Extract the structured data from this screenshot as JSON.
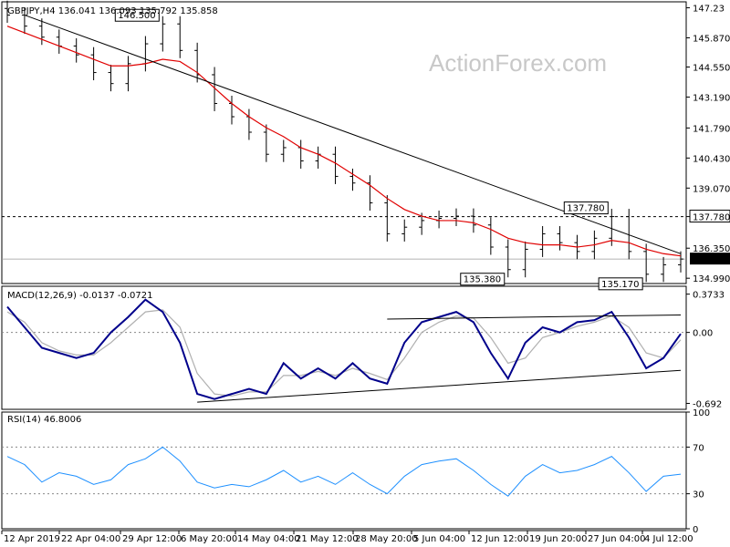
{
  "chart_data": [
    {
      "type": "candlestick",
      "title": "GBPJPY,H4",
      "ohlc": "136.041 136.093 135.792 135.858",
      "watermark": "ActionForex.com",
      "y_ticks": [
        "147.23",
        "145.870",
        "144.550",
        "143.190",
        "141.790",
        "140.430",
        "139.070",
        "137.780",
        "136.350",
        "134.990"
      ],
      "current_price": "135.858",
      "ylim": [
        134.75,
        147.5
      ],
      "x_labels": [
        "12 Apr 2019",
        "22 Apr 04:00",
        "29 Apr 12:00",
        "6 May 20:00",
        "14 May 04:00",
        "21 May 12:00",
        "28 May 20:00",
        "5 Jun 04:00",
        "12 Jun 12:00",
        "19 Jun 20:00",
        "27 Jun 04:00",
        "4 Jul 12:00"
      ],
      "close": [
        146.9,
        146.4,
        145.9,
        145.5,
        145.1,
        144.3,
        143.8,
        144.7,
        145.6,
        146.5,
        145.3,
        144.2,
        142.9,
        142.3,
        141.6,
        140.6,
        140.9,
        140.3,
        140.6,
        139.6,
        139.3,
        138.4,
        137.0,
        137.3,
        137.6,
        137.7,
        137.8,
        137.4,
        136.4,
        135.38,
        136.3,
        137.0,
        136.6,
        136.2,
        136.8,
        137.78,
        136.2,
        135.17,
        135.6,
        135.858
      ],
      "moving_average": [
        146.4,
        146.1,
        145.8,
        145.5,
        145.2,
        144.9,
        144.6,
        144.6,
        144.7,
        144.9,
        144.8,
        144.3,
        143.6,
        142.9,
        142.3,
        141.8,
        141.4,
        140.9,
        140.6,
        140.2,
        139.7,
        139.2,
        138.6,
        138.1,
        137.8,
        137.6,
        137.6,
        137.5,
        137.2,
        136.8,
        136.6,
        136.5,
        136.5,
        136.4,
        136.5,
        136.7,
        136.6,
        136.3,
        136.1,
        136.0
      ],
      "trendline": {
        "from": [
          1,
          146.9
        ],
        "to": [
          39,
          136.1
        ]
      },
      "resistance_level": 137.78,
      "annotations": [
        {
          "text": "146.500",
          "at": [
            9,
            146.5
          ]
        },
        {
          "text": "137.780",
          "at": [
            35,
            137.78
          ]
        },
        {
          "text": "135.380",
          "at": [
            29,
            135.38
          ]
        },
        {
          "text": "135.170",
          "at": [
            37,
            135.17
          ]
        }
      ]
    },
    {
      "type": "line",
      "title": "MACD(12,26,9) -0.0137 -0.0721",
      "y_ticks": [
        "0.3733",
        "0.00",
        "-0.692"
      ],
      "ylim": [
        -0.75,
        0.45
      ],
      "macd": [
        0.25,
        0.05,
        -0.15,
        -0.2,
        -0.25,
        -0.2,
        0.0,
        0.15,
        0.32,
        0.2,
        -0.1,
        -0.6,
        -0.65,
        -0.6,
        -0.55,
        -0.6,
        -0.3,
        -0.45,
        -0.35,
        -0.45,
        -0.3,
        -0.45,
        -0.5,
        -0.1,
        0.1,
        0.15,
        0.2,
        0.1,
        -0.2,
        -0.45,
        -0.1,
        0.05,
        0.0,
        0.1,
        0.12,
        0.2,
        -0.05,
        -0.35,
        -0.25,
        -0.0137
      ],
      "signal": [
        0.2,
        0.1,
        -0.1,
        -0.18,
        -0.22,
        -0.22,
        -0.1,
        0.05,
        0.2,
        0.22,
        0.05,
        -0.4,
        -0.6,
        -0.62,
        -0.58,
        -0.58,
        -0.42,
        -0.42,
        -0.38,
        -0.42,
        -0.35,
        -0.4,
        -0.46,
        -0.25,
        0.0,
        0.1,
        0.16,
        0.14,
        -0.05,
        -0.3,
        -0.25,
        -0.05,
        0.0,
        0.06,
        0.1,
        0.16,
        0.05,
        -0.2,
        -0.25,
        -0.0721
      ]
    },
    {
      "type": "line",
      "title": "RSI(14) 46.8006",
      "y_ticks": [
        "100",
        "70",
        "30",
        "0"
      ],
      "ylim": [
        0,
        100
      ],
      "rsi": [
        62,
        55,
        40,
        48,
        45,
        38,
        42,
        55,
        60,
        70,
        58,
        40,
        35,
        38,
        36,
        42,
        50,
        40,
        45,
        38,
        48,
        38,
        30,
        45,
        55,
        58,
        60,
        50,
        38,
        28,
        45,
        55,
        48,
        50,
        55,
        62,
        48,
        32,
        45,
        46.8
      ]
    }
  ]
}
